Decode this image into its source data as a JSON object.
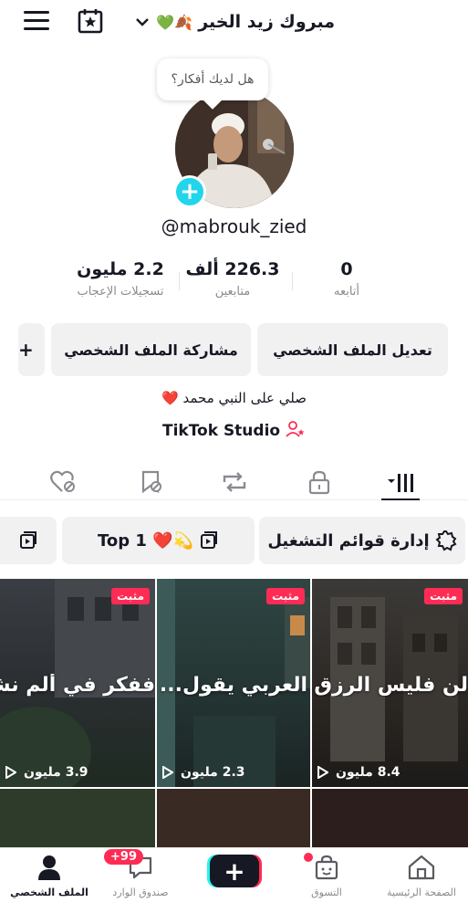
{
  "header": {
    "username": "مبروك زيد الخير",
    "username_emojis": "💚🍂"
  },
  "profile": {
    "thought_bubble": "هل لديك أفكار؟",
    "handle": "@mabrouk_zied",
    "stats": [
      {
        "value": "0",
        "label": "أتابعه"
      },
      {
        "value": "226.3 ألف",
        "label": "متابعين"
      },
      {
        "value": "2.2 مليون",
        "label": "تسجيلات الإعجاب"
      }
    ],
    "edit_button": "تعديل الملف الشخصي",
    "share_button": "مشاركة الملف الشخصي",
    "add_friend_button": "+",
    "bio": "صلي على النبي محمد ❤️",
    "studio_link": "TikTok Studio"
  },
  "tabs": [
    "videos-grid",
    "private-lock",
    "reposts",
    "favorites",
    "liked"
  ],
  "playlists": {
    "manage_label": "إدارة قوائم التشغيل",
    "top_playlist": "Top 1 ❤️💫"
  },
  "videos": [
    {
      "pinned": "مثبت",
      "caption": "لن فليس الرزق با",
      "views": "8.4 مليون"
    },
    {
      "pinned": "مثبت",
      "caption": "العربي يقول...",
      "views": "2.3 مليون"
    },
    {
      "pinned": "مثبت",
      "caption": "ففكر في ألم نشرح",
      "views": "3.9 مليون"
    }
  ],
  "nav": {
    "home": "الصفحة الرئيسية",
    "shop": "التسوق",
    "inbox": "صندوق الوارد",
    "inbox_badge": "+99",
    "profile": "الملف الشخصي"
  },
  "colors": {
    "accent_red": "#fe2c55",
    "accent_cyan": "#20d5ec",
    "text": "#161823",
    "button_bg": "#f1f1f2"
  }
}
